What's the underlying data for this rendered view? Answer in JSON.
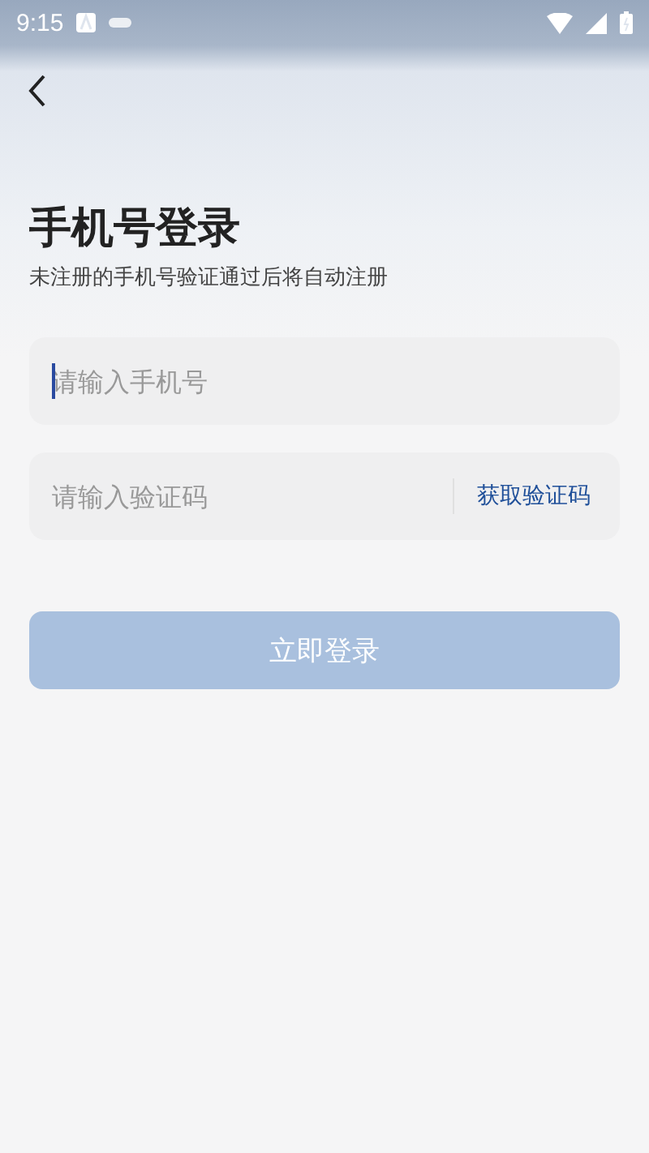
{
  "status_bar": {
    "time": "9:15"
  },
  "title": "手机号登录",
  "subtitle": "未注册的手机号验证通过后将自动注册",
  "phone_field": {
    "placeholder": "请输入手机号",
    "focused": true
  },
  "code_field": {
    "placeholder": "请输入验证码",
    "action": "获取验证码"
  },
  "login_button": {
    "label": "立即登录",
    "disabled": true
  }
}
